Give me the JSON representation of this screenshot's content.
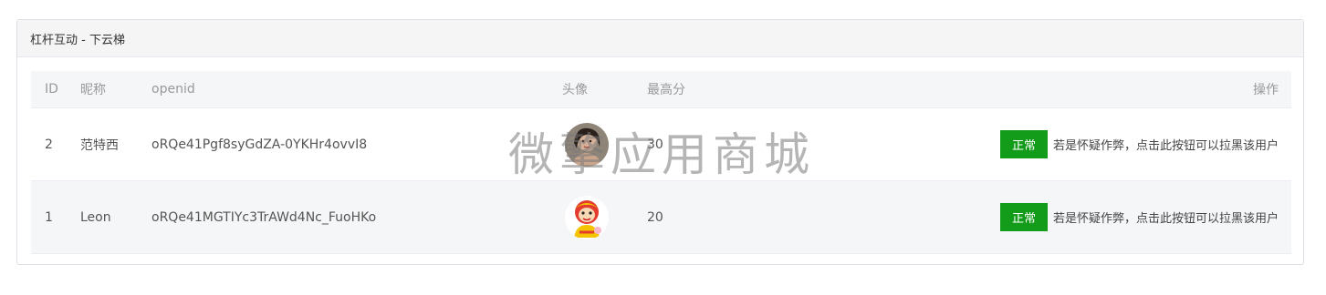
{
  "panel": {
    "title": "杠杆互动 - 下云梯"
  },
  "table": {
    "headers": [
      "ID",
      "昵称",
      "openid",
      "头像",
      "最高分",
      "操作"
    ],
    "rows": [
      {
        "id": "2",
        "nickname": "范特西",
        "openid": "oRQe41Pgf8syGdZA-0YKHr4ovvI8",
        "avatar_icon": "female-portrait-avatar",
        "score": "30",
        "status_label": "正常",
        "action_hint": "若是怀疑作弊，点击此按钮可以拉黑该用户"
      },
      {
        "id": "1",
        "nickname": "Leon",
        "openid": "oRQe41MGTIYc3TrAWd4Nc_FuoHKo",
        "avatar_icon": "cartoon-monkey-avatar",
        "score": "20",
        "status_label": "正常",
        "action_hint": "若是怀疑作弊，点击此按钮可以拉黑该用户"
      }
    ]
  },
  "watermark": "微擎应用商城",
  "colors": {
    "status_button": "#139c1a",
    "header_bg": "#f5f5f5",
    "row_alt_bg": "#f5f6f8"
  }
}
